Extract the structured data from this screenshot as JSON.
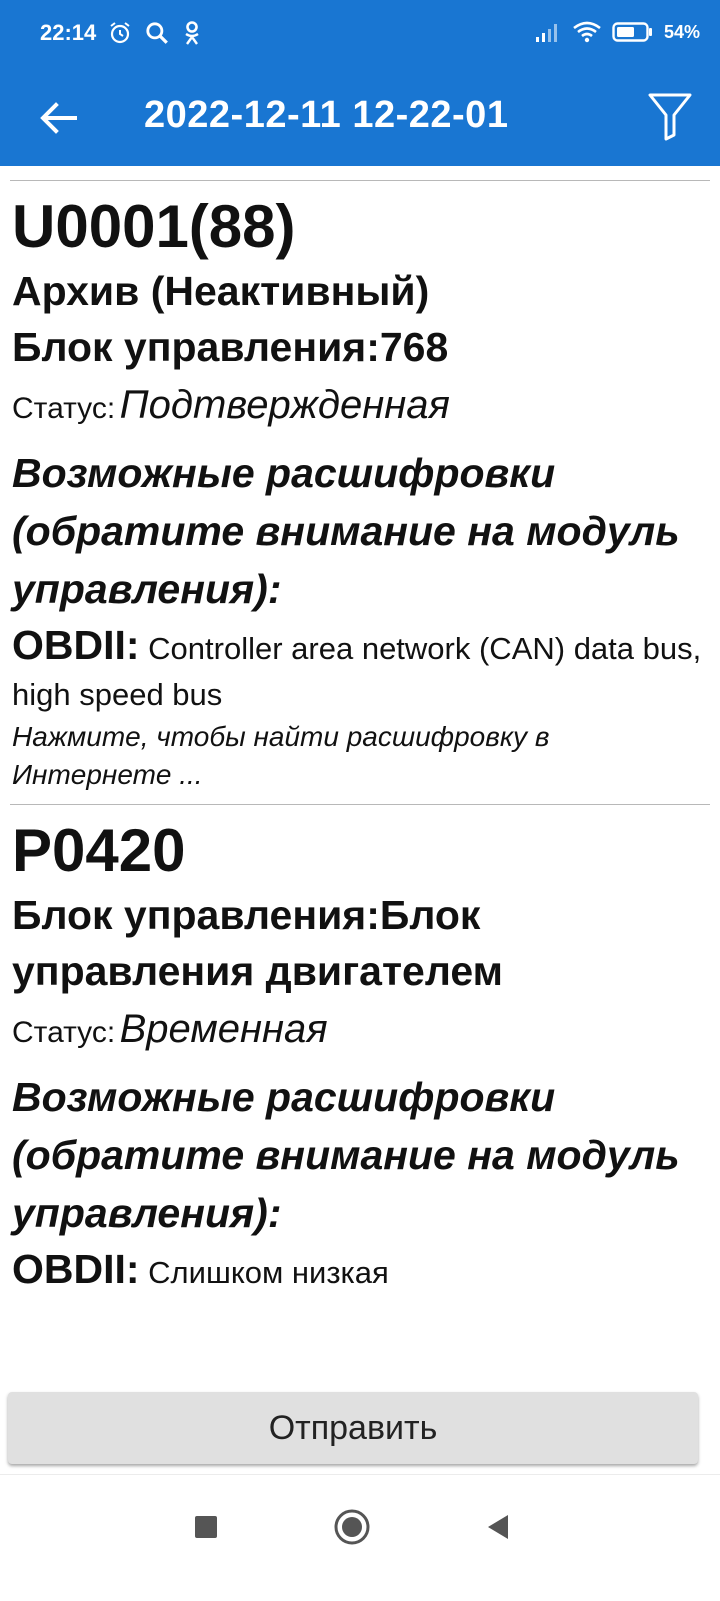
{
  "status_bar": {
    "time": "22:14",
    "battery": "54%",
    "icons": [
      "alarm-icon",
      "search-icon",
      "odnoklassniki-icon",
      "signal-icon",
      "wifi-icon",
      "battery-icon"
    ]
  },
  "app_bar": {
    "title": "2022-12-11 12-22-01",
    "back_icon": "arrow-left-icon",
    "filter_icon": "filter-icon"
  },
  "records": [
    {
      "code": "U0001(88)",
      "archive": "Архив (Неактивный)",
      "control_unit": "Блок управления:768",
      "status_label": "Статус:",
      "status_value": "Подтвержденная",
      "decode_heading": "Возможные расшифровки (обратите внимание на модуль управления):",
      "obd_label": "OBDII:",
      "obd_text": "Controller area network (CAN) data bus, high speed bus",
      "search_hint": "Нажмите, чтобы найти расшифровку в Интернете ..."
    },
    {
      "code": "P0420",
      "control_unit": "Блок управления:Блок управления двигателем",
      "status_label": "Статус:",
      "status_value": "Временная",
      "decode_heading": "Возможные расшифровки (обратите внимание на модуль управления):",
      "obd_label": "OBDII:",
      "obd_text": "Слишком низкая"
    }
  ],
  "send_button": "Отправить",
  "nav_bar": {
    "icons": [
      "recents-icon",
      "home-icon",
      "back-icon"
    ]
  },
  "colors": {
    "primary": "#1976d2",
    "button_bg": "#e0e0e0"
  }
}
